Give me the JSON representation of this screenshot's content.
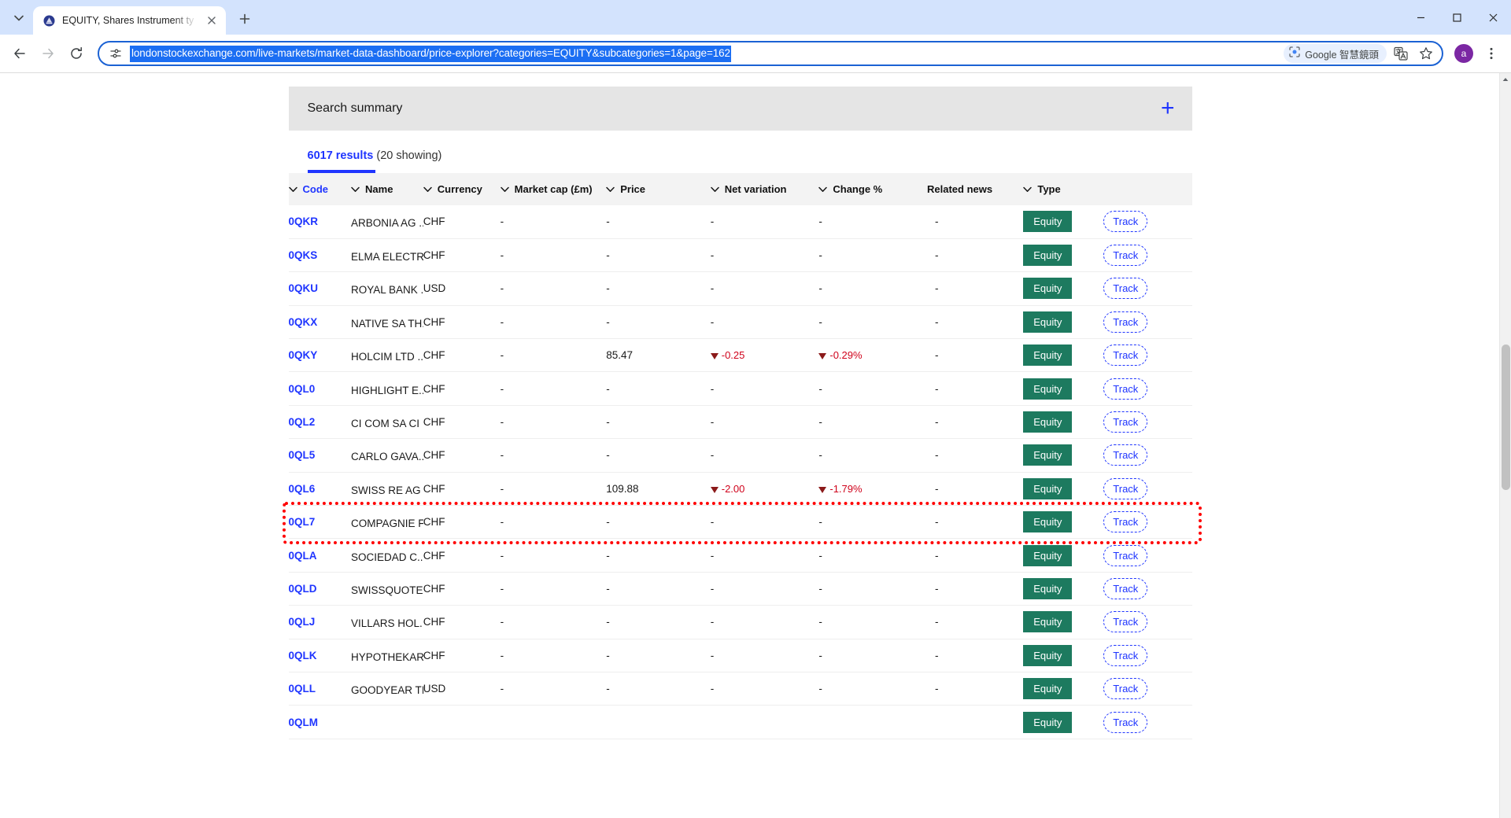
{
  "browser": {
    "tab": {
      "title": "EQUITY, Shares Instrument ty",
      "favicon": "lse-crest-icon"
    },
    "tablist_button": "tab-search-icon",
    "newtab_button": "+",
    "window_controls": {
      "minimize": "minimize-icon",
      "maximize": "maximize-icon",
      "close": "close-icon"
    },
    "nav": {
      "back": "back-arrow-icon",
      "forward": "forward-arrow-icon",
      "reload": "reload-icon"
    },
    "omnibox": {
      "site_info_icon": "page-settings-icon",
      "url": "londonstockexchange.com/live-markets/market-data-dashboard/price-explorer?categories=EQUITY&subcategories=1&page=162",
      "lens_chip_label": "Google 智慧鏡頭",
      "lens_chip_icon": "google-lens-icon",
      "translate_icon": "translate-icon",
      "bookmark_icon": "star-icon"
    },
    "profile_avatar": "a",
    "menu_icon": "three-dot-menu-icon",
    "colors": {
      "tabstrip": "#d3e3fd",
      "omnibox_border": "#1b62d4",
      "url_selection": "#1b6ef3",
      "avatar": "#7b27a3"
    }
  },
  "page": {
    "search_summary": {
      "label": "Search summary",
      "expand_icon": "plus-icon"
    },
    "results": {
      "count_label": "6017 results",
      "showing_label": "(20 showing)"
    },
    "table": {
      "columns": [
        {
          "label": "Code",
          "sortable": true
        },
        {
          "label": "Name",
          "sortable": true
        },
        {
          "label": "Currency",
          "sortable": true
        },
        {
          "label": "Market cap (£m)",
          "sortable": true
        },
        {
          "label": "Price",
          "sortable": true
        },
        {
          "label": "Net variation",
          "sortable": true
        },
        {
          "label": "Change %",
          "sortable": true
        },
        {
          "label": "Related news",
          "sortable": false
        },
        {
          "label": "Type",
          "sortable": true
        }
      ],
      "rows": [
        {
          "code": "0QKR",
          "name": "ARBONIA AG ...",
          "currency": "CHF",
          "market_cap": "-",
          "price": "-",
          "net_variation": "-",
          "change_pct": "-",
          "related_news": "-",
          "type": "Equity",
          "action": "Track",
          "negative": false
        },
        {
          "code": "0QKS",
          "name": "ELMA ELECTR...",
          "currency": "CHF",
          "market_cap": "-",
          "price": "-",
          "net_variation": "-",
          "change_pct": "-",
          "related_news": "-",
          "type": "Equity",
          "action": "Track",
          "negative": false
        },
        {
          "code": "0QKU",
          "name": "ROYAL BANK ...",
          "currency": "USD",
          "market_cap": "-",
          "price": "-",
          "net_variation": "-",
          "change_pct": "-",
          "related_news": "-",
          "type": "Equity",
          "action": "Track",
          "negative": false
        },
        {
          "code": "0QKX",
          "name": "NATIVE SA TH...",
          "currency": "CHF",
          "market_cap": "-",
          "price": "-",
          "net_variation": "-",
          "change_pct": "-",
          "related_news": "-",
          "type": "Equity",
          "action": "Track",
          "negative": false
        },
        {
          "code": "0QKY",
          "name": "HOLCIM LTD ...",
          "currency": "CHF",
          "market_cap": "-",
          "price": "85.47",
          "net_variation": "-0.25",
          "change_pct": "-0.29%",
          "related_news": "-",
          "type": "Equity",
          "action": "Track",
          "negative": true
        },
        {
          "code": "0QL0",
          "name": "HIGHLIGHT E...",
          "currency": "CHF",
          "market_cap": "-",
          "price": "-",
          "net_variation": "-",
          "change_pct": "-",
          "related_news": "-",
          "type": "Equity",
          "action": "Track",
          "negative": false
        },
        {
          "code": "0QL2",
          "name": "CI COM SA CI ...",
          "currency": "CHF",
          "market_cap": "-",
          "price": "-",
          "net_variation": "-",
          "change_pct": "-",
          "related_news": "-",
          "type": "Equity",
          "action": "Track",
          "negative": false
        },
        {
          "code": "0QL5",
          "name": "CARLO GAVA...",
          "currency": "CHF",
          "market_cap": "-",
          "price": "-",
          "net_variation": "-",
          "change_pct": "-",
          "related_news": "-",
          "type": "Equity",
          "action": "Track",
          "negative": false
        },
        {
          "code": "0QL6",
          "name": "SWISS RE AG ...",
          "currency": "CHF",
          "market_cap": "-",
          "price": "109.88",
          "net_variation": "-2.00",
          "change_pct": "-1.79%",
          "related_news": "-",
          "type": "Equity",
          "action": "Track",
          "negative": true
        },
        {
          "code": "0QL7",
          "name": "COMPAGNIE F...",
          "currency": "CHF",
          "market_cap": "-",
          "price": "-",
          "net_variation": "-",
          "change_pct": "-",
          "related_news": "-",
          "type": "Equity",
          "action": "Track",
          "negative": false,
          "highlighted": true
        },
        {
          "code": "0QLA",
          "name": "SOCIEDAD C...",
          "currency": "CHF",
          "market_cap": "-",
          "price": "-",
          "net_variation": "-",
          "change_pct": "-",
          "related_news": "-",
          "type": "Equity",
          "action": "Track",
          "negative": false
        },
        {
          "code": "0QLD",
          "name": "SWISSQUOTE ...",
          "currency": "CHF",
          "market_cap": "-",
          "price": "-",
          "net_variation": "-",
          "change_pct": "-",
          "related_news": "-",
          "type": "Equity",
          "action": "Track",
          "negative": false
        },
        {
          "code": "0QLJ",
          "name": "VILLARS HOL...",
          "currency": "CHF",
          "market_cap": "-",
          "price": "-",
          "net_variation": "-",
          "change_pct": "-",
          "related_news": "-",
          "type": "Equity",
          "action": "Track",
          "negative": false
        },
        {
          "code": "0QLK",
          "name": "HYPOTHEKAR...",
          "currency": "CHF",
          "market_cap": "-",
          "price": "-",
          "net_variation": "-",
          "change_pct": "-",
          "related_news": "-",
          "type": "Equity",
          "action": "Track",
          "negative": false
        },
        {
          "code": "0QLL",
          "name": "GOODYEAR TI...",
          "currency": "USD",
          "market_cap": "-",
          "price": "-",
          "net_variation": "-",
          "change_pct": "-",
          "related_news": "-",
          "type": "Equity",
          "action": "Track",
          "negative": false
        },
        {
          "code": "0QLM",
          "name": "",
          "currency": "",
          "market_cap": "",
          "price": "",
          "net_variation": "",
          "change_pct": "",
          "related_news": "",
          "type": "Equity",
          "action": "Track",
          "negative": false
        }
      ]
    },
    "colors": {
      "link_blue": "#1f35ff",
      "equity_badge": "#1d7a5f",
      "negative_red": "#d0021b",
      "triangle_red": "#8b1a1a",
      "summary_bg": "#e5e5e5",
      "highlight_outline": "#ff0000"
    }
  }
}
